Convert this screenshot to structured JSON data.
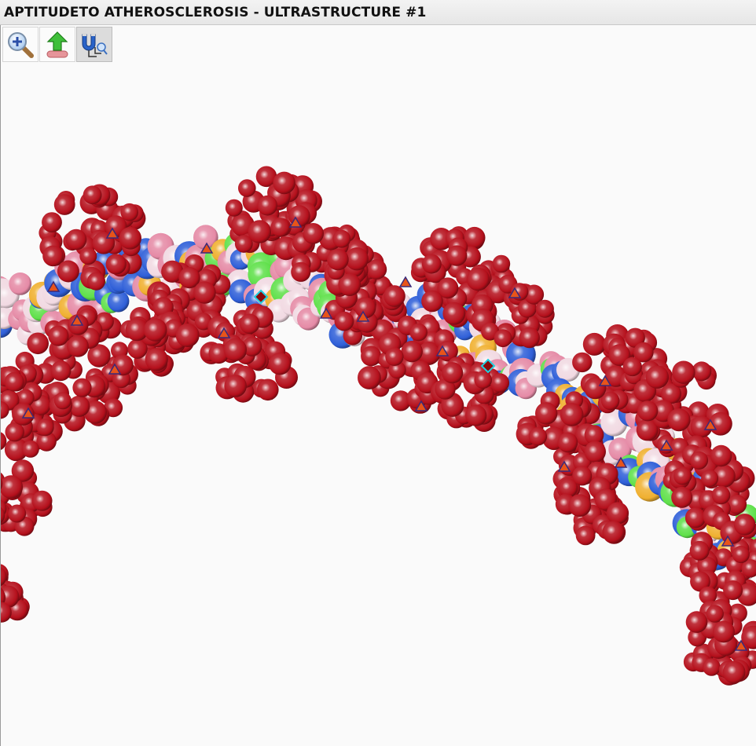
{
  "window": {
    "title": "APTITUDETO ATHEROSCLEROSIS - ULTRASTRUCTURE #1"
  },
  "toolbar": {
    "buttons": [
      {
        "icon": "zoom-in-icon",
        "active": false
      },
      {
        "icon": "upload-icon",
        "active": false
      },
      {
        "icon": "magnet-select-icon",
        "active": true
      }
    ]
  },
  "model": {
    "colors": {
      "backbone": "#b5101c",
      "base_blue": "#2f5fd8",
      "base_green": "#5fe04a",
      "base_pink": "#e58aa6",
      "base_white": "#f1d9e2",
      "base_orange": "#f0b030",
      "marker_triangle": "#e8541a",
      "marker_outline": "#3a2a7a",
      "marker_diamond": "#8b0a0a",
      "marker_diamond_outline": "#20d0e0"
    }
  }
}
